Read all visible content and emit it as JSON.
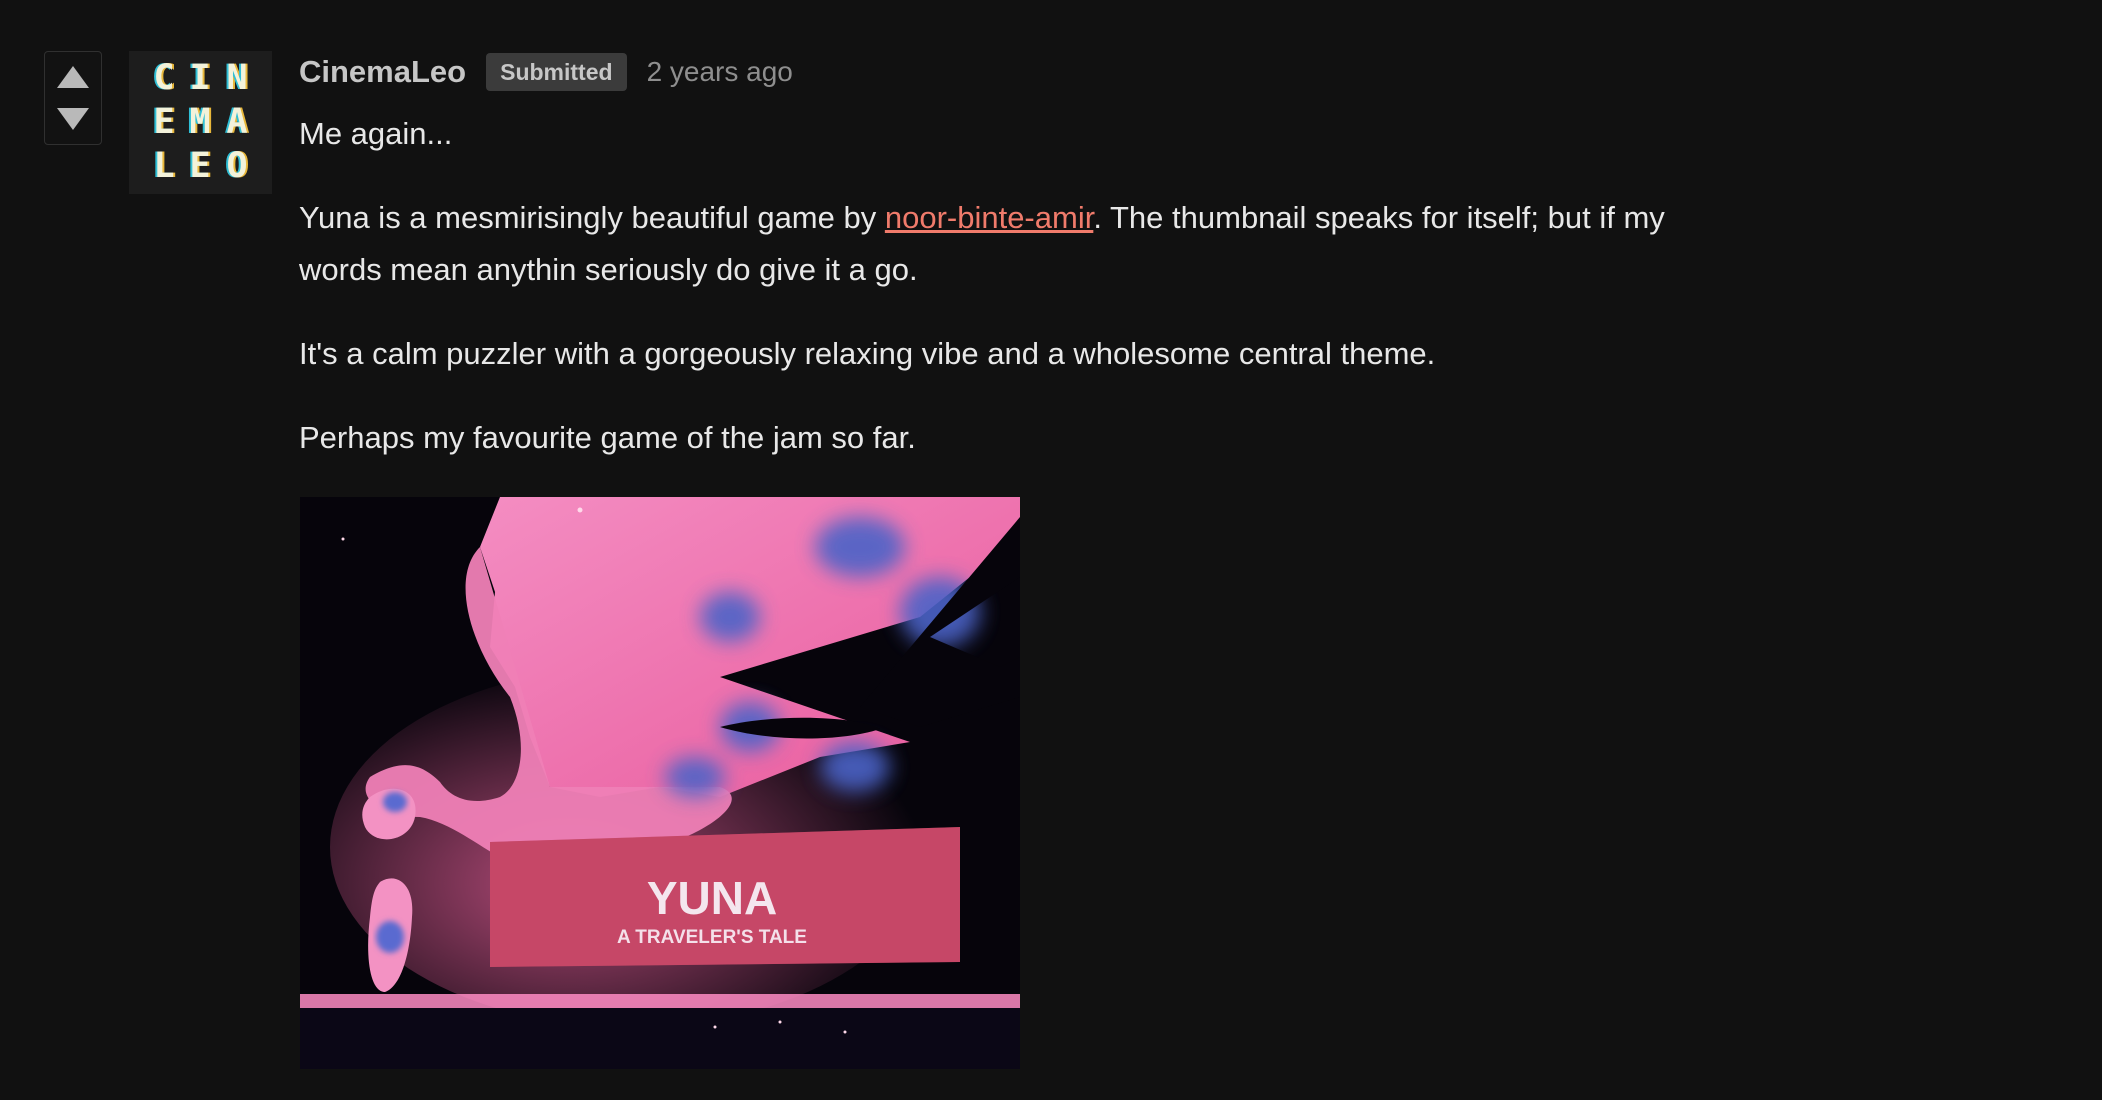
{
  "vote": {
    "up_icon": "triangle-up-icon",
    "down_icon": "triangle-down-icon"
  },
  "avatar": {
    "letters": [
      "C",
      "I",
      "N",
      "E",
      "M",
      "A",
      "L",
      "E",
      "O"
    ]
  },
  "comment": {
    "username": "CinemaLeo",
    "badge": "Submitted",
    "timestamp": "2 years ago",
    "p1": "Me again...",
    "p2_before": "Yuna is a mesmirisingly beautiful game by ",
    "p2_link": "noor-binte-amir",
    "p2_after": ". The thumbnail speaks for itself; but if my words mean anythin seriously do give it a go.",
    "p3": "It's a calm puzzler with a gorgeously relaxing vibe and a wholesome central theme.",
    "p4": "Perhaps my favourite game of the jam so far."
  },
  "image": {
    "title": "YUNA",
    "subtitle": "A TRAVELER'S TALE"
  },
  "colors": {
    "background": "#111111",
    "link": "#f07b6b",
    "badge_bg": "#3b3b3b",
    "pink": "#f07fb2"
  }
}
